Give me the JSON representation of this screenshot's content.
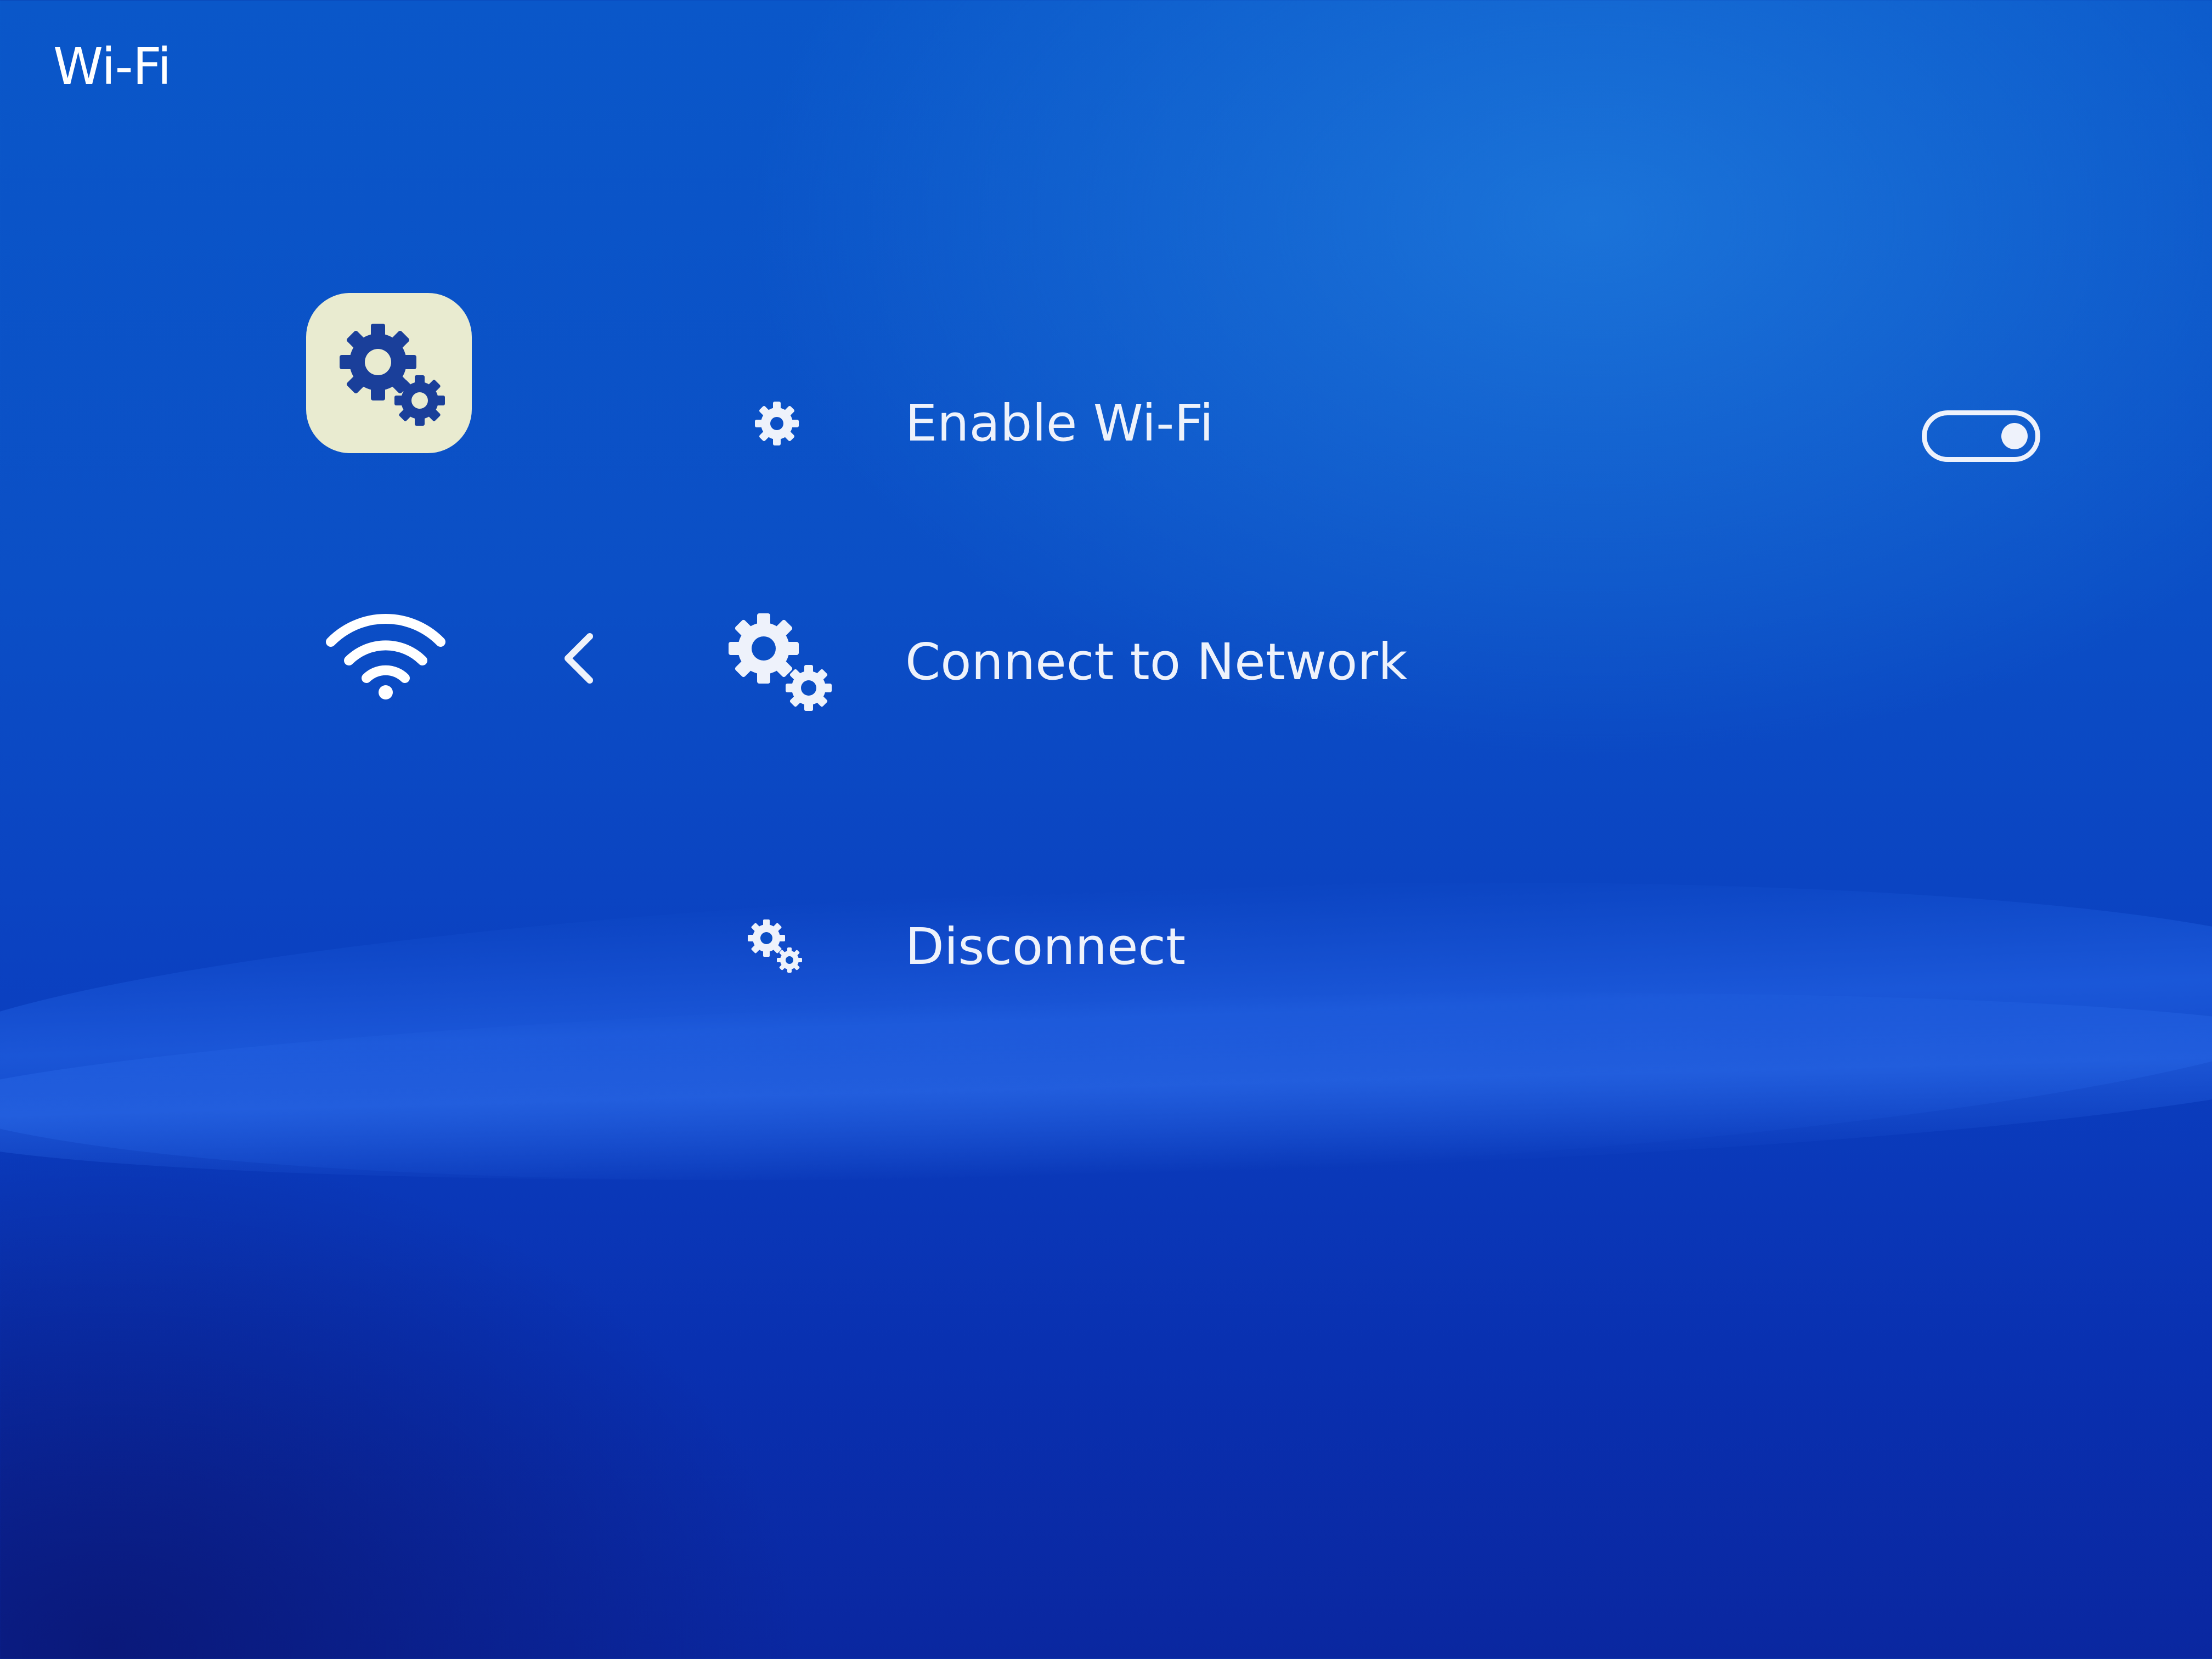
{
  "header": {
    "title": "Wi-Fi"
  },
  "sidebar": {
    "app_icon": "settings-gears-icon",
    "current_icon": "wifi-icon",
    "back_icon": "chevron-left-icon"
  },
  "menu": {
    "items": [
      {
        "label": "Enable Wi-Fi",
        "icon": "gear-icon",
        "control": "toggle",
        "toggle_on": true
      },
      {
        "label": "Connect to Network",
        "icon": "gears-icon"
      },
      {
        "label": "Disconnect",
        "icon": "gears-icon"
      }
    ]
  },
  "colors": {
    "background_top": "#0a57c9",
    "background_bottom": "#0a27a0",
    "text": "#eef2fb",
    "tile": "#e9ebd0",
    "tile_icon": "#1a3f9a"
  }
}
